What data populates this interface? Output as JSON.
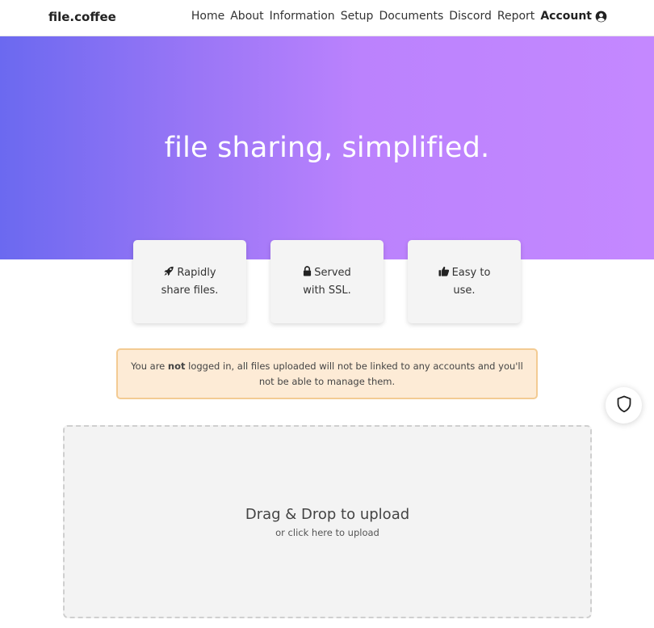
{
  "navbar": {
    "brand": "file.coffee",
    "links": [
      "Home",
      "About",
      "Information",
      "Setup",
      "Documents",
      "Discord",
      "Report"
    ],
    "account_label": "Account"
  },
  "hero": {
    "headline": "file sharing, simplified."
  },
  "features": [
    {
      "icon": "rocket-icon",
      "line1": "Rapidly",
      "line2": "share files."
    },
    {
      "icon": "lock-icon",
      "line1": "Served",
      "line2": "with SSL."
    },
    {
      "icon": "thumbs-up-icon",
      "line1": "Easy to",
      "line2": "use."
    }
  ],
  "notice": {
    "prefix": "You are ",
    "emphasis": "not",
    "suffix": " logged in, all files uploaded will not be linked to any accounts and you'll not be able to manage them."
  },
  "upload": {
    "title": "Drag & Drop to upload",
    "subtitle": "or click here to upload"
  },
  "colors": {
    "hero_gradient_start": "#6b69f0",
    "hero_gradient_end": "#c488ff",
    "notice_bg": "#fdebd6",
    "notice_border": "#f3cb93"
  }
}
